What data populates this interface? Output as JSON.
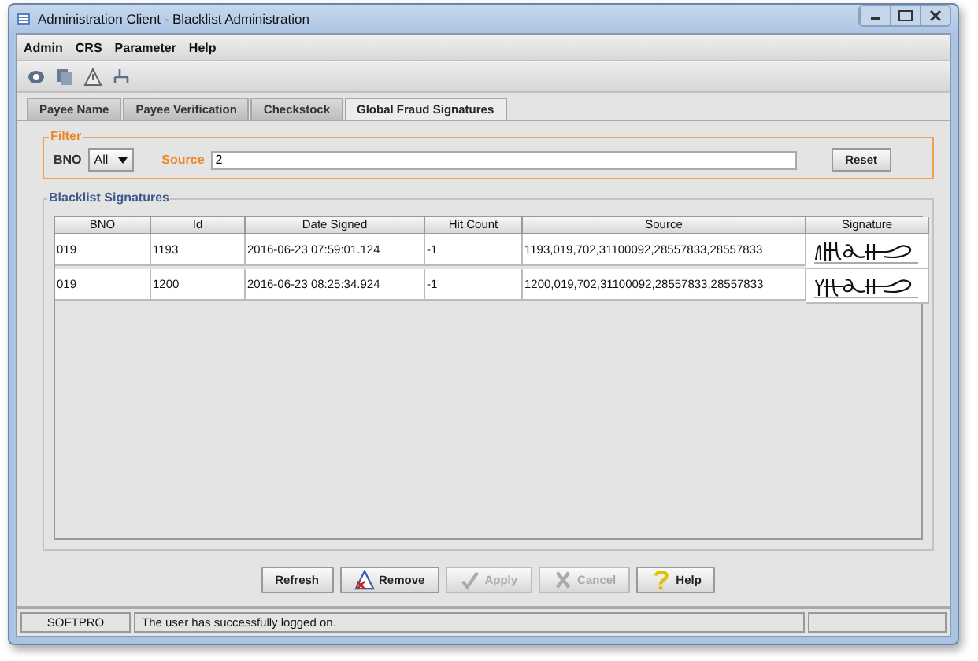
{
  "window": {
    "title": "Administration Client - Blacklist Administration"
  },
  "menu": [
    "Admin",
    "CRS",
    "Parameter",
    "Help"
  ],
  "tabs": [
    {
      "label": "Payee Name",
      "selected": false
    },
    {
      "label": "Payee Verification",
      "selected": false
    },
    {
      "label": "Checkstock",
      "selected": false
    },
    {
      "label": "Global Fraud Signatures",
      "selected": true
    }
  ],
  "filter": {
    "title": "Filter",
    "bno_label": "BNO",
    "bno_value": "All",
    "source_label": "Source",
    "source_value": "2",
    "reset": "Reset"
  },
  "table": {
    "title": "Blacklist Signatures",
    "columns": [
      "BNO",
      "Id",
      "Date Signed",
      "Hit Count",
      "Source",
      "Signature"
    ],
    "rows": [
      {
        "cells": [
          "019",
          "1193",
          "2016-06-23 07:59:01.124",
          "-1",
          "1193,019,702,31100092,28557833,28557833"
        ],
        "selected": false
      },
      {
        "cells": [
          "019",
          "1200",
          "2016-06-23 08:25:34.924",
          "-1",
          "1200,019,702,31100092,28557833,28557833"
        ],
        "selected": false
      }
    ]
  },
  "buttons": [
    {
      "label": "Refresh",
      "kind": "plain",
      "disabled": false
    },
    {
      "label": "Remove",
      "kind": "remove",
      "disabled": false
    },
    {
      "label": "Apply",
      "kind": "apply",
      "disabled": true
    },
    {
      "label": "Cancel",
      "kind": "cancel",
      "disabled": true
    },
    {
      "label": "Help",
      "kind": "help",
      "disabled": false
    }
  ],
  "status_bar": {
    "user": "SOFTPRO",
    "message": "The user has successfully logged on."
  }
}
